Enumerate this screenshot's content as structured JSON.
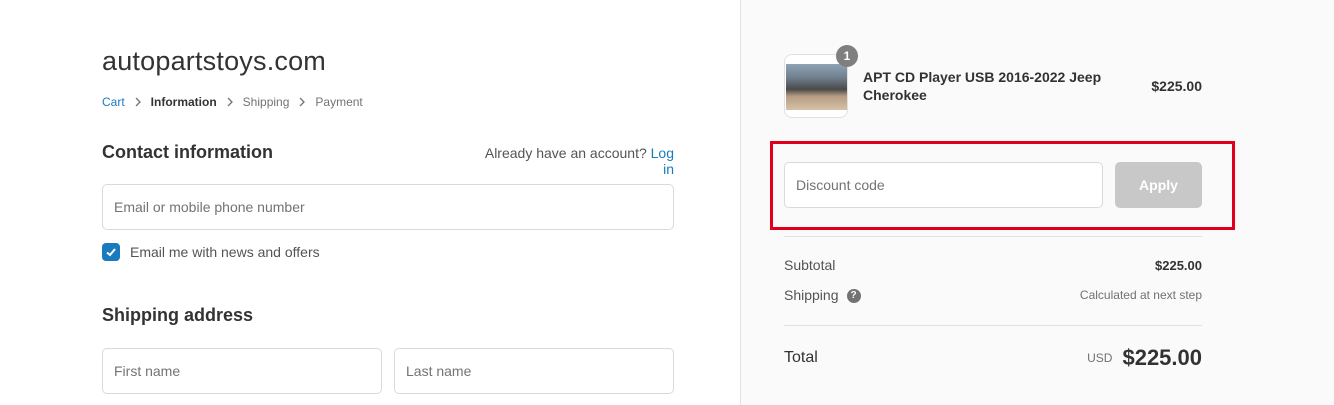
{
  "shop": {
    "name": "autopartstoys.com"
  },
  "breadcrumb": [
    {
      "label": "Cart"
    },
    {
      "label": "Information"
    },
    {
      "label": "Shipping"
    },
    {
      "label": "Payment"
    }
  ],
  "contact": {
    "title": "Contact information",
    "account_prompt": "Already have an account?",
    "login_label": "Log in",
    "email_placeholder": "Email or mobile phone number",
    "newsletter_label": "Email me with news and offers",
    "newsletter_checked": true
  },
  "shipping": {
    "title": "Shipping address",
    "first_name_placeholder": "First name",
    "last_name_placeholder": "Last name"
  },
  "order": {
    "product": {
      "name": "APT CD Player USB 2016-2022 Jeep Cherokee",
      "price": "$225.00",
      "quantity": "1"
    },
    "discount": {
      "placeholder": "Discount code",
      "apply_label": "Apply"
    },
    "subtotal_label": "Subtotal",
    "subtotal_value": "$225.00",
    "shipping_label": "Shipping",
    "shipping_value": "Calculated at next step",
    "total_label": "Total",
    "currency": "USD",
    "total_value": "$225.00"
  },
  "colors": {
    "link": "#197bbd",
    "highlight_border": "#e0001b",
    "apply_disabled": "#c8c8c8",
    "sidebar_bg": "#fafafa"
  }
}
